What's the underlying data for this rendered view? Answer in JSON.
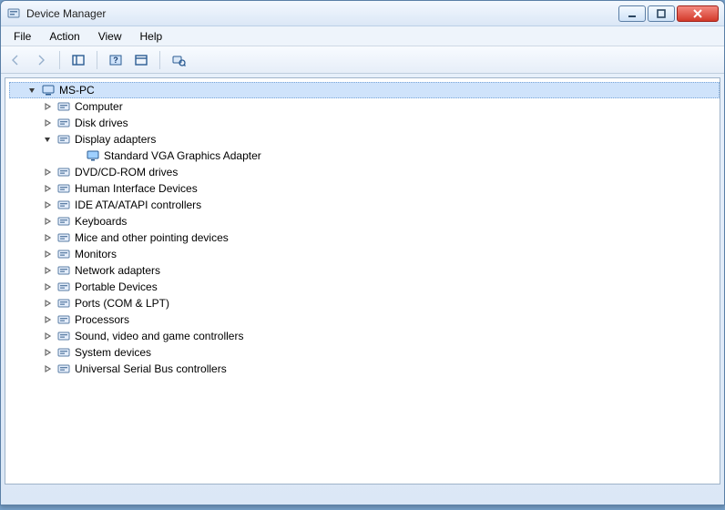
{
  "window": {
    "title": "Device Manager"
  },
  "menu": {
    "file": "File",
    "action": "Action",
    "view": "View",
    "help": "Help"
  },
  "tree": {
    "root": "MS-PC",
    "items": [
      {
        "label": "Computer"
      },
      {
        "label": "Disk drives"
      },
      {
        "label": "Display adapters",
        "expanded": true,
        "children": [
          {
            "label": "Standard VGA Graphics Adapter"
          }
        ]
      },
      {
        "label": "DVD/CD-ROM drives"
      },
      {
        "label": "Human Interface Devices"
      },
      {
        "label": "IDE ATA/ATAPI controllers"
      },
      {
        "label": "Keyboards"
      },
      {
        "label": "Mice and other pointing devices"
      },
      {
        "label": "Monitors"
      },
      {
        "label": "Network adapters"
      },
      {
        "label": "Portable Devices"
      },
      {
        "label": "Ports (COM & LPT)"
      },
      {
        "label": "Processors"
      },
      {
        "label": "Sound, video and game controllers"
      },
      {
        "label": "System devices"
      },
      {
        "label": "Universal Serial Bus controllers"
      }
    ]
  }
}
